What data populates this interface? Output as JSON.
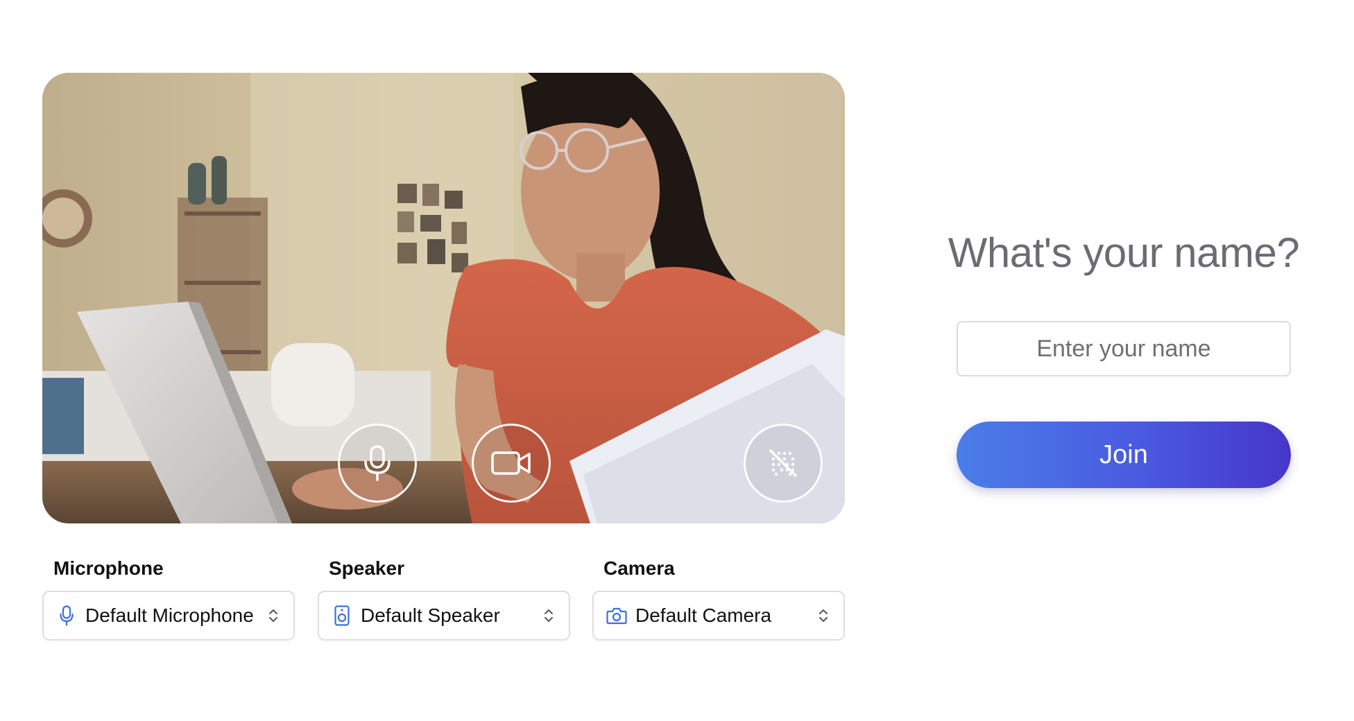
{
  "preview": {
    "controls": {
      "mic_icon": "microphone-icon",
      "camera_icon": "video-camera-icon",
      "background_icon": "background-blur-off-icon"
    }
  },
  "devices": {
    "microphone": {
      "label": "Microphone",
      "value": "Default Microphone",
      "icon": "microphone-icon"
    },
    "speaker": {
      "label": "Speaker",
      "value": "Default Speaker",
      "icon": "speaker-icon"
    },
    "camera": {
      "label": "Camera",
      "value": "Default Camera",
      "icon": "camera-icon"
    }
  },
  "join": {
    "heading": "What's your name?",
    "name_placeholder": "Enter your name",
    "name_value": "",
    "button_label": "Join"
  },
  "colors": {
    "accent_blue": "#4a7ee8",
    "accent_indigo": "#4636c9",
    "heading_gray": "#6b6b73",
    "icon_blue": "#3b6fe0"
  }
}
